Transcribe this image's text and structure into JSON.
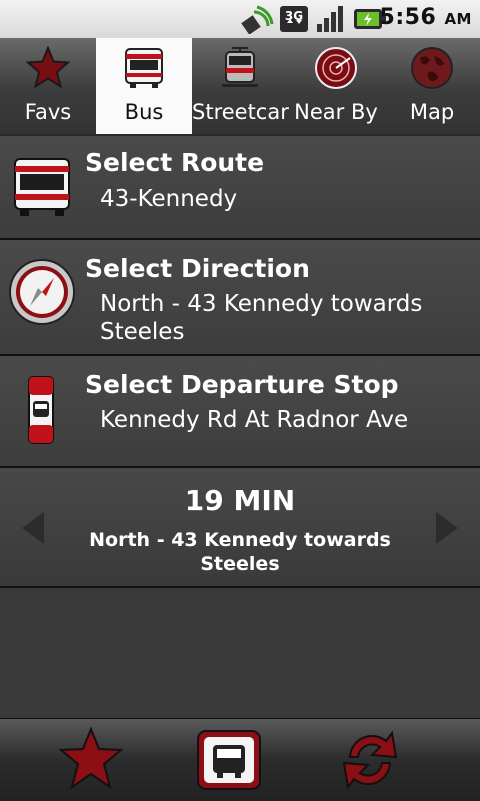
{
  "status": {
    "time": "5:56",
    "ampm": "AM",
    "network": "3G"
  },
  "tabs": [
    {
      "label": "Favs",
      "icon": "star-icon"
    },
    {
      "label": "Bus",
      "icon": "bus-icon",
      "selected": true
    },
    {
      "label": "Streetcar",
      "icon": "streetcar-icon"
    },
    {
      "label": "Near By",
      "icon": "radar-icon"
    },
    {
      "label": "Map",
      "icon": "globe-icon"
    }
  ],
  "route": {
    "title": "Select Route",
    "value": "43-Kennedy"
  },
  "direction": {
    "title": "Select Direction",
    "value": "North - 43 Kennedy towards Steeles"
  },
  "stop": {
    "title": "Select Departure Stop",
    "value": "Kennedy Rd At Radnor Ave"
  },
  "prediction": {
    "time": "19 MIN",
    "direction": "North - 43 Kennedy towards Steeles"
  },
  "colors": {
    "accent": "#8b0f14",
    "background": "#3a3a3a"
  }
}
